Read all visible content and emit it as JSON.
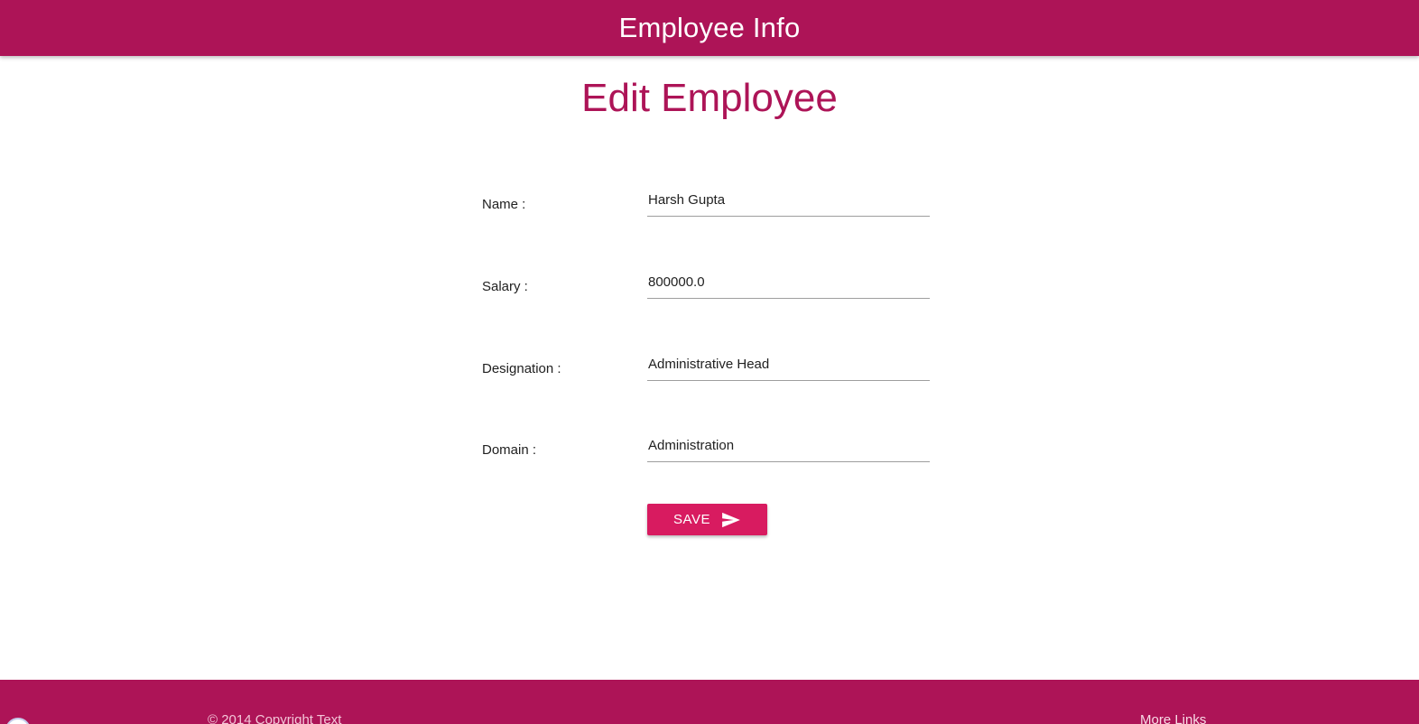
{
  "header": {
    "title": "Employee Info"
  },
  "page": {
    "title": "Edit Employee"
  },
  "form": {
    "fields": [
      {
        "label": "Name :",
        "value": "Harsh Gupta"
      },
      {
        "label": "Salary :",
        "value": "800000.0"
      },
      {
        "label": "Designation :",
        "value": "Administrative Head"
      },
      {
        "label": "Domain :",
        "value": "Administration"
      }
    ],
    "save_label": "SAVE",
    "save_icon": "send-icon"
  },
  "footer": {
    "copyright": "© 2014 Copyright Text",
    "more_links": "More Links"
  },
  "colors": {
    "primary": "#ad1457",
    "button": "#d81b60",
    "text": "#212121"
  }
}
